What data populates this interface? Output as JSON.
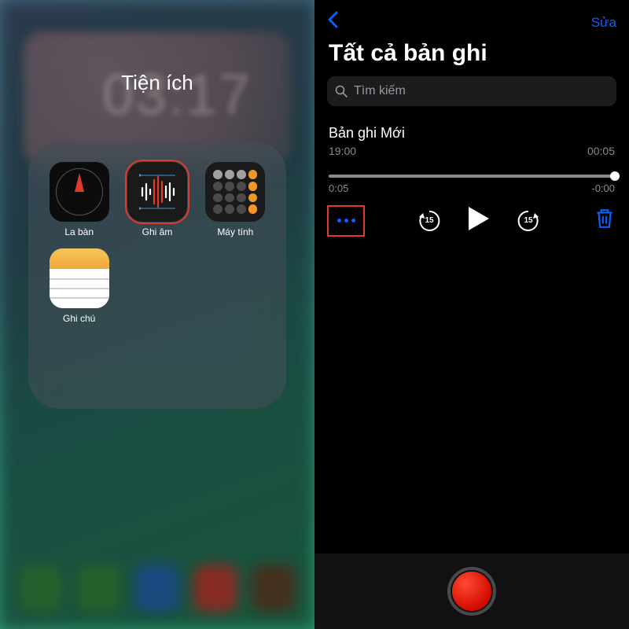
{
  "left": {
    "folder_title": "Tiện ích",
    "background_time": "03:17",
    "apps": [
      {
        "key": "compass",
        "label": "La bàn",
        "highlighted": false
      },
      {
        "key": "voice",
        "label": "Ghi âm",
        "highlighted": true
      },
      {
        "key": "calc",
        "label": "Máy tính",
        "highlighted": false
      },
      {
        "key": "notes",
        "label": "Ghi chú",
        "highlighted": false
      }
    ],
    "dock_app_colors": [
      "#3aa24a",
      "#3aa24a",
      "#2a7ad4",
      "#e04a3a",
      "#705030"
    ]
  },
  "right": {
    "edit_label": "Sửa",
    "page_title": "Tất cả bản ghi",
    "search_placeholder": "Tìm kiếm",
    "recording": {
      "title": "Bản ghi Mới",
      "timestamp": "19:00",
      "duration": "00:05",
      "elapsed": "0:05",
      "remaining": "-0:00"
    },
    "skip_seconds": "15",
    "colors": {
      "accent": "#0a60ff",
      "highlight": "#e03a2a"
    }
  }
}
